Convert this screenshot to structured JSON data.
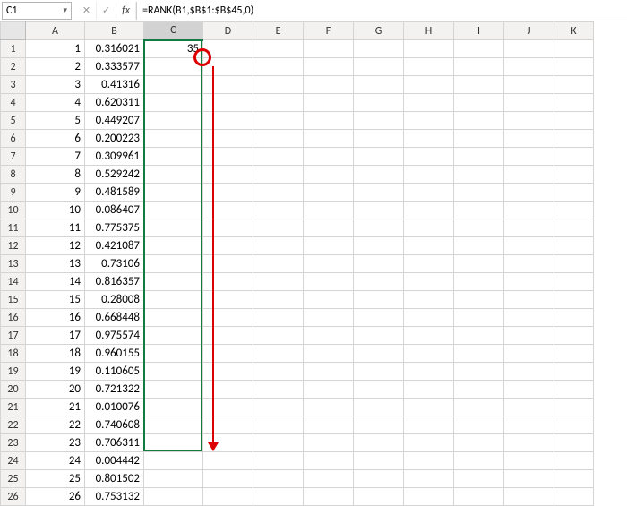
{
  "toolbar": {
    "namebox": "C1",
    "cancel_icon": "✕",
    "confirm_icon": "✓",
    "fx_label": "fx",
    "formula": "=RANK(B1,$B$1:$B$45,0)"
  },
  "columns": [
    "A",
    "B",
    "C",
    "D",
    "E",
    "F",
    "G",
    "H",
    "I",
    "J",
    "K"
  ],
  "selected_column": "C",
  "rows": [
    {
      "r": 1,
      "A": "1",
      "B": "0.316021",
      "C": "35"
    },
    {
      "r": 2,
      "A": "2",
      "B": "0.333577",
      "C": ""
    },
    {
      "r": 3,
      "A": "3",
      "B": "0.41316",
      "C": ""
    },
    {
      "r": 4,
      "A": "4",
      "B": "0.620311",
      "C": ""
    },
    {
      "r": 5,
      "A": "5",
      "B": "0.449207",
      "C": ""
    },
    {
      "r": 6,
      "A": "6",
      "B": "0.200223",
      "C": ""
    },
    {
      "r": 7,
      "A": "7",
      "B": "0.309961",
      "C": ""
    },
    {
      "r": 8,
      "A": "8",
      "B": "0.529242",
      "C": ""
    },
    {
      "r": 9,
      "A": "9",
      "B": "0.481589",
      "C": ""
    },
    {
      "r": 10,
      "A": "10",
      "B": "0.086407",
      "C": ""
    },
    {
      "r": 11,
      "A": "11",
      "B": "0.775375",
      "C": ""
    },
    {
      "r": 12,
      "A": "12",
      "B": "0.421087",
      "C": ""
    },
    {
      "r": 13,
      "A": "13",
      "B": "0.73106",
      "C": ""
    },
    {
      "r": 14,
      "A": "14",
      "B": "0.816357",
      "C": ""
    },
    {
      "r": 15,
      "A": "15",
      "B": "0.28008",
      "C": ""
    },
    {
      "r": 16,
      "A": "16",
      "B": "0.668448",
      "C": ""
    },
    {
      "r": 17,
      "A": "17",
      "B": "0.975574",
      "C": ""
    },
    {
      "r": 18,
      "A": "18",
      "B": "0.960155",
      "C": ""
    },
    {
      "r": 19,
      "A": "19",
      "B": "0.110605",
      "C": ""
    },
    {
      "r": 20,
      "A": "20",
      "B": "0.721322",
      "C": ""
    },
    {
      "r": 21,
      "A": "21",
      "B": "0.010076",
      "C": ""
    },
    {
      "r": 22,
      "A": "22",
      "B": "0.740608",
      "C": ""
    },
    {
      "r": 23,
      "A": "23",
      "B": "0.706311",
      "C": ""
    },
    {
      "r": 24,
      "A": "24",
      "B": "0.004442",
      "C": ""
    },
    {
      "r": 25,
      "A": "25",
      "B": "0.801502",
      "C": ""
    },
    {
      "r": 26,
      "A": "26",
      "B": "0.753132",
      "C": ""
    }
  ]
}
